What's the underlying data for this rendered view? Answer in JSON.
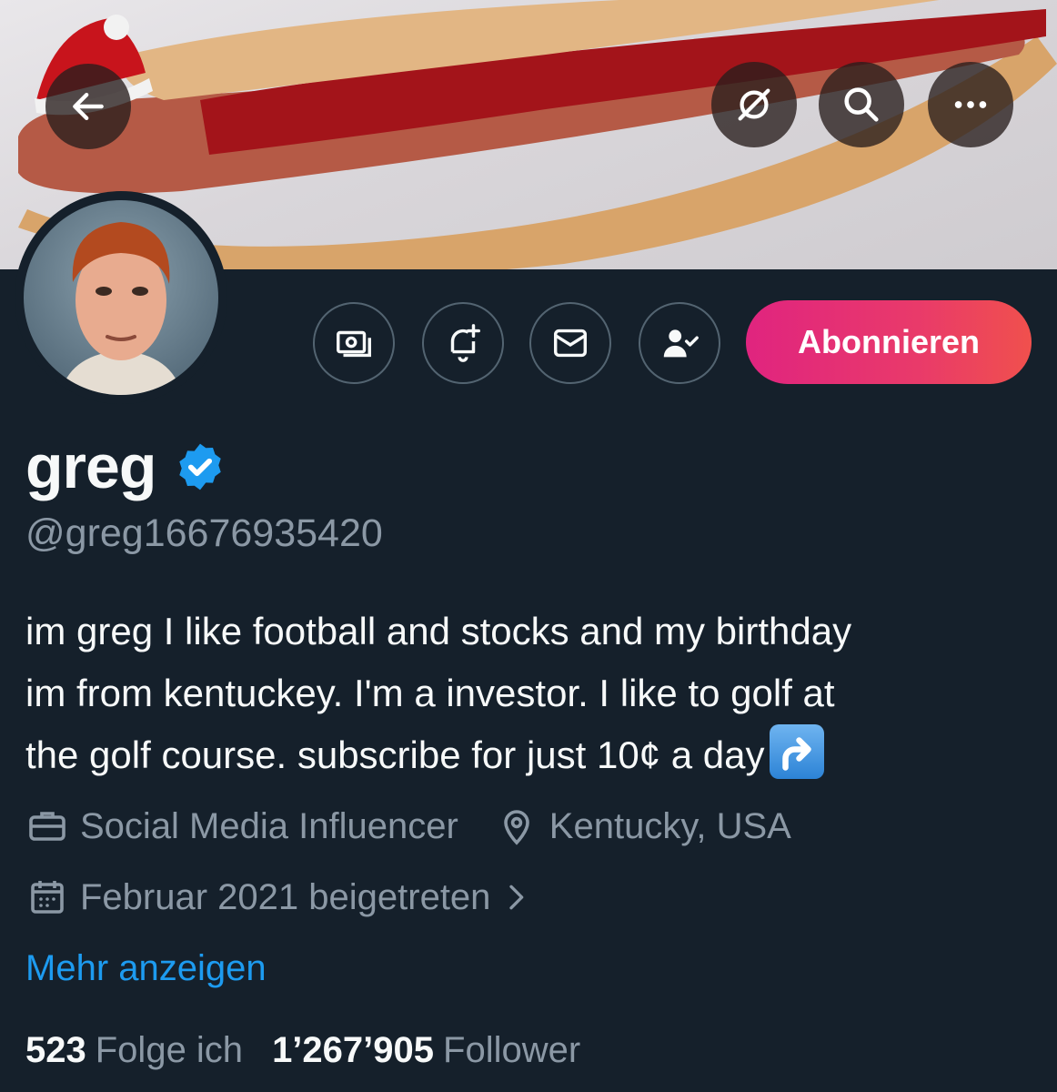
{
  "profile": {
    "display_name": "greg",
    "handle": "@greg16676935420",
    "verified": true,
    "bio": [
      "im greg I like football and stocks and my birthday",
      "im from kentuckey. I'm a investor. I like to golf at",
      "the golf course. subscribe for just 10¢ a day"
    ],
    "bio_emoji": "arrow-right-curving-up-emoji",
    "category": "Social Media Influencer",
    "location": "Kentucky, USA",
    "joined": "Februar 2021 beigetreten",
    "show_more": "Mehr anzeigen"
  },
  "actions": {
    "subscribe_label": "Abonnieren"
  },
  "stats": {
    "following_count": "523",
    "following_label": "Folge ich",
    "followers_count": "1’267’905",
    "followers_label": "Follower"
  },
  "colors": {
    "background": "#15202b",
    "accent_blue": "#1d9bf0",
    "muted": "#8b98a5",
    "subscribe_gradient_start": "#e0247f",
    "subscribe_gradient_end": "#f0504d"
  },
  "icons": [
    "back-arrow-icon",
    "translate-off-icon",
    "search-icon",
    "more-icon",
    "money-icon",
    "notification-add-icon",
    "envelope-icon",
    "following-check-icon",
    "verified-badge-icon",
    "briefcase-icon",
    "location-pin-icon",
    "calendar-icon",
    "chevron-right-icon"
  ]
}
